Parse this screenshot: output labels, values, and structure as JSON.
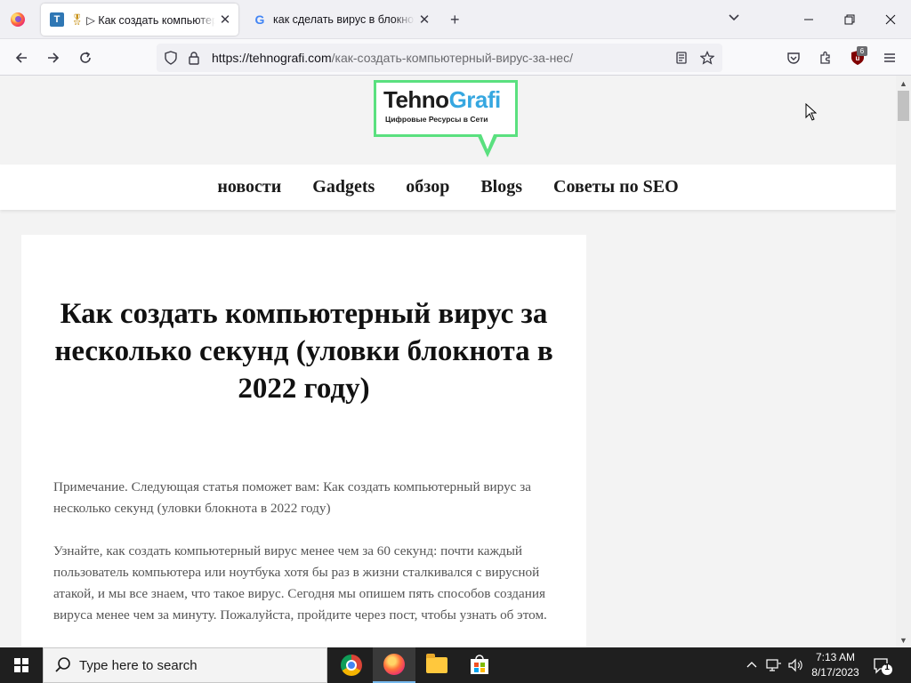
{
  "browser": {
    "tabs": [
      {
        "title": "▷ Как создать компьютерный вирус",
        "active": true,
        "favicon": "tehnografi-favicon",
        "badge_icon": "medal-icon"
      },
      {
        "title": "как сделать вирус в блокноте",
        "active": false,
        "favicon": "google-favicon"
      }
    ],
    "new_tab_glyph": "+",
    "tab_list_glyph": "⌄",
    "url_scheme_host": "https://tehnografi.com",
    "url_path": "/как-создать-компьютерный-вирус-за-нес/",
    "extension_badge": "6"
  },
  "site": {
    "logo_part1": "Tehno",
    "logo_part2": "Grafi",
    "logo_tagline": "Цифровые Ресурсы в Сети",
    "nav": [
      "новости",
      "Gadgets",
      "обзор",
      "Blogs",
      "Советы по SEO"
    ]
  },
  "article": {
    "title": "Как создать компьютерный вирус за несколько секунд (уловки блокнота в 2022 году)",
    "paragraphs": [
      "Примечание. Следующая статья поможет вам: Как создать компьютерный вирус за несколько секунд (уловки блокнота в 2022 году)",
      "Узнайте, как создать компьютерный вирус менее чем за 60 секунд: почти каждый пользователь компьютера или ноутбука хотя бы раз в жизни сталкивался с вирусной атакой, и мы все знаем, что такое вирус. Сегодня мы опишем пять способов создания вируса менее чем за минуту. Пожалуйста, пройдите через пост, чтобы узнать об этом."
    ]
  },
  "taskbar": {
    "search_placeholder": "Type here to search",
    "time": "7:13 AM",
    "date": "8/17/2023",
    "notification_count": "1",
    "apps": [
      "chrome-icon",
      "firefox-icon",
      "file-explorer-icon",
      "store-icon"
    ]
  },
  "colors": {
    "logo_green": "#5ae07f",
    "logo_blue": "#36a7e0",
    "taskbar_bg": "#1f1f1f"
  }
}
